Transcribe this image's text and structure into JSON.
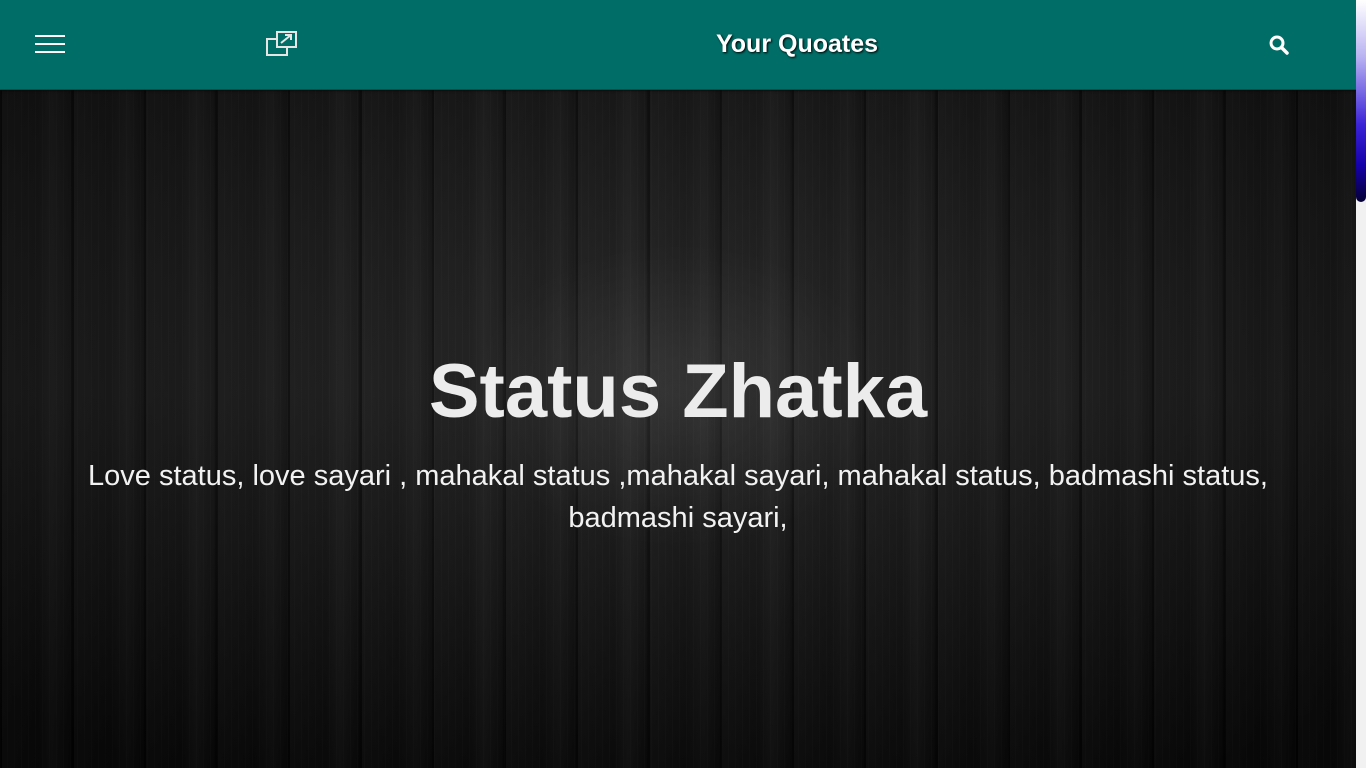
{
  "header": {
    "site_title": "Your Quoates",
    "icons": {
      "menu": "hamburger-menu-icon",
      "popout": "external-window-icon",
      "search": "search-icon"
    },
    "background_color": "#006d66"
  },
  "hero": {
    "title": "Status Zhatka",
    "subtitle": "Love status, love sayari , mahakal status ,mahakal sayari, mahakal status, badmashi status, badmashi sayari,",
    "background": "dark-wood-texture"
  },
  "scrollbar": {
    "thumb_color": "#1400a8",
    "scroll_position": 0
  }
}
